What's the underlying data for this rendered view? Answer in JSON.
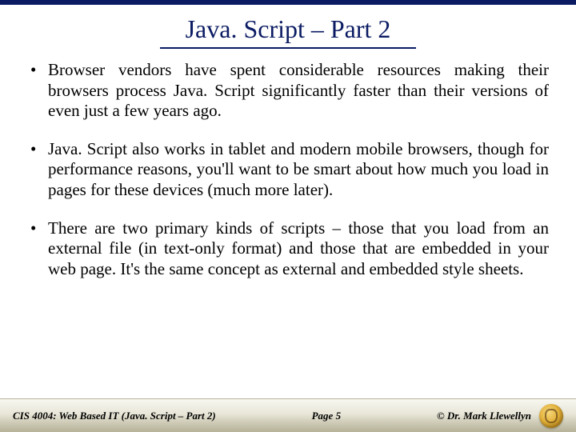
{
  "title": "Java. Script – Part 2",
  "bullets": [
    "Browser vendors have spent considerable resources making their browsers process Java. Script significantly faster than their versions of even just a few years ago.",
    "Java. Script also works in tablet and modern mobile browsers, though for performance reasons, you'll want to be smart about how much you load in pages for these devices (much more later).",
    "There are two primary kinds of scripts – those that you load from an external file (in text-only format) and those that are embedded in your web page.  It's the same concept as external and embedded style sheets."
  ],
  "footer": {
    "left": "CIS 4004: Web Based IT (Java. Script – Part 2)",
    "center": "Page 5",
    "right": "© Dr. Mark Llewellyn"
  }
}
